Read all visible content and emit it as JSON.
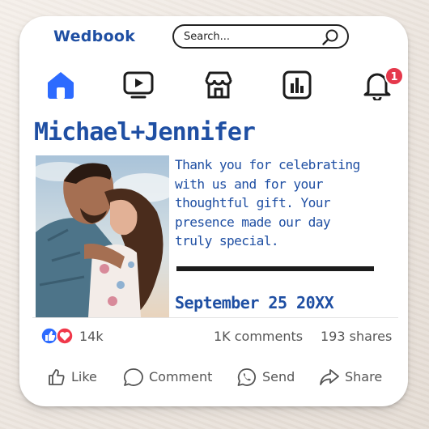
{
  "app": {
    "name": "Wedbook"
  },
  "search": {
    "placeholder": "Search..."
  },
  "nav": {
    "items": [
      {
        "icon": "home-icon",
        "active": true
      },
      {
        "icon": "video-icon",
        "active": false
      },
      {
        "icon": "store-icon",
        "active": false
      },
      {
        "icon": "chart-icon",
        "active": false
      },
      {
        "icon": "bell-icon",
        "active": false
      }
    ],
    "notification_count": "1"
  },
  "post": {
    "title": "Michael+Jennifer",
    "message_lines": [
      "Thank you for celebrating",
      "with us and for your",
      "thoughtful gift. Your",
      "presence made our day",
      "truly special."
    ],
    "date": "September 25 20XX"
  },
  "stats": {
    "reactions": "14k",
    "comments": "1K comments",
    "shares": "193 shares"
  },
  "actions": {
    "like": "Like",
    "comment": "Comment",
    "send": "Send",
    "share": "Share"
  },
  "colors": {
    "brand": "#1f4fa3",
    "active_nav": "#2d6bff",
    "badge": "#e5384b",
    "text_muted": "#555555"
  }
}
